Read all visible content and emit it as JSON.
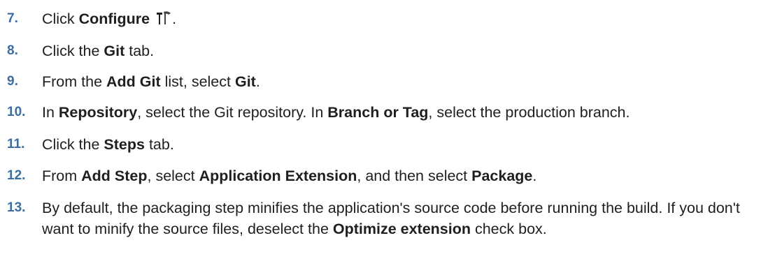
{
  "steps": [
    {
      "num": "7.",
      "parts": [
        {
          "t": "Click "
        },
        {
          "t": "Configure",
          "b": true
        },
        {
          "t": " "
        },
        {
          "icon": "hammer-wrench-icon"
        },
        {
          "t": "."
        }
      ]
    },
    {
      "num": "8.",
      "parts": [
        {
          "t": "Click the "
        },
        {
          "t": "Git",
          "b": true
        },
        {
          "t": " tab."
        }
      ]
    },
    {
      "num": "9.",
      "parts": [
        {
          "t": "From the "
        },
        {
          "t": "Add Git",
          "b": true
        },
        {
          "t": " list, select "
        },
        {
          "t": "Git",
          "b": true
        },
        {
          "t": "."
        }
      ]
    },
    {
      "num": "10.",
      "parts": [
        {
          "t": "In "
        },
        {
          "t": "Repository",
          "b": true
        },
        {
          "t": ", select the Git repository. In "
        },
        {
          "t": "Branch or Tag",
          "b": true
        },
        {
          "t": ", select the production branch."
        }
      ]
    },
    {
      "num": "11.",
      "parts": [
        {
          "t": "Click the "
        },
        {
          "t": "Steps",
          "b": true
        },
        {
          "t": " tab."
        }
      ]
    },
    {
      "num": "12.",
      "parts": [
        {
          "t": "From "
        },
        {
          "t": "Add Step",
          "b": true
        },
        {
          "t": ", select "
        },
        {
          "t": "Application Extension",
          "b": true
        },
        {
          "t": ", and then select "
        },
        {
          "t": "Package",
          "b": true
        },
        {
          "t": "."
        }
      ]
    },
    {
      "num": "13.",
      "parts": [
        {
          "t": "By default, the packaging step minifies the application's source code before running the build. If you don't want to minify the source files, deselect the "
        },
        {
          "t": "Optimize extension",
          "b": true
        },
        {
          "t": " check box."
        }
      ]
    }
  ]
}
